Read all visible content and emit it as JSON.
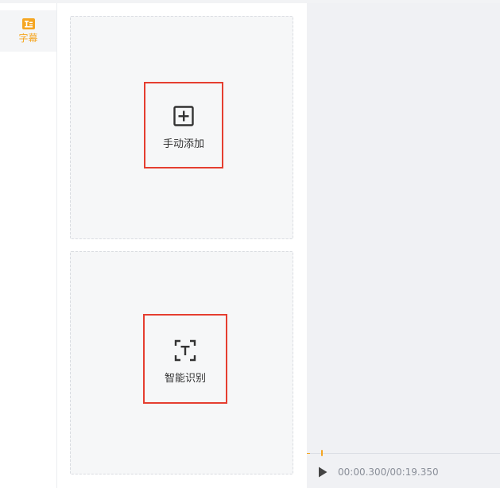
{
  "sidebar": {
    "items": [
      {
        "label": "字幕",
        "icon": "subtitle-icon",
        "active": true,
        "color": "#f5a623"
      }
    ]
  },
  "panel": {
    "manual_add": {
      "label": "手动添加",
      "icon": "plus-square-icon"
    },
    "auto_recognize": {
      "label": "智能识别",
      "icon": "text-scan-icon"
    }
  },
  "player": {
    "current_time": "00:00.300",
    "total_time": "00:19.350",
    "time_display": "00:00.300/00:19.350",
    "progress": 0.0155,
    "accent_color": "#f5a623"
  },
  "colors": {
    "highlight_border": "#e53e30",
    "card_background": "#f6f7f8",
    "preview_background": "#f0f1f4"
  }
}
